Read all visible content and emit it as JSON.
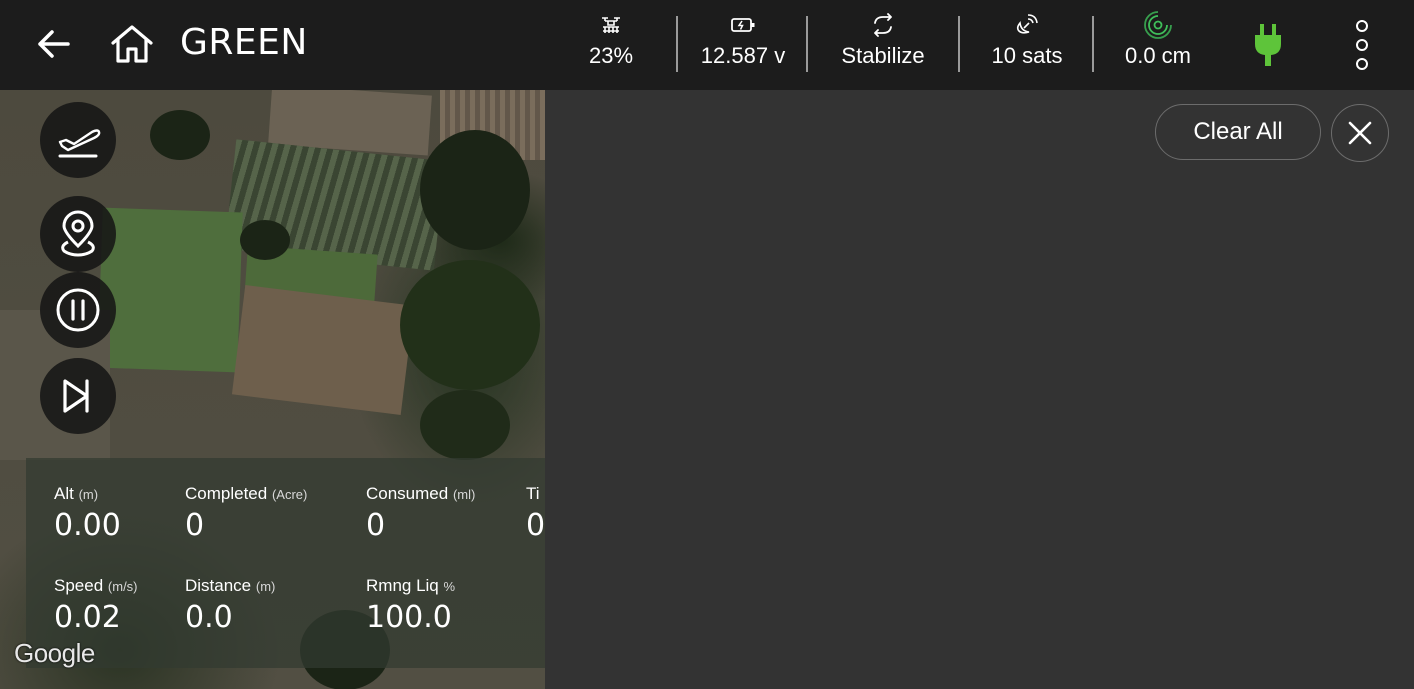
{
  "header": {
    "title": "GREEN",
    "back_icon": "arrow-left-icon",
    "home_icon": "home-icon",
    "stats": [
      {
        "icon": "drone-icon",
        "value": "23%"
      },
      {
        "icon": "battery-icon",
        "value": "12.587 v"
      },
      {
        "icon": "mode-sync-icon",
        "value": "Stabilize"
      },
      {
        "icon": "satellite-icon",
        "value": "10 sats"
      },
      {
        "icon": "rtk-signal-icon",
        "value": "0.0 cm",
        "icon_color": "#3fbf5a"
      }
    ],
    "plug_icon": "power-plug-icon",
    "plug_color": "#5ec43a",
    "menu_icon": "more-vertical-icon"
  },
  "map": {
    "buttons": [
      "takeoff-land-icon",
      "location-pin-icon",
      "pause-icon",
      "skip-next-icon"
    ],
    "attribution": "Google",
    "telemetry": {
      "alt": {
        "label": "Alt",
        "unit": "(m)",
        "value": "0.00"
      },
      "completed": {
        "label": "Completed",
        "unit": "(Acre)",
        "value": "0"
      },
      "consumed": {
        "label": "Consumed",
        "unit": "(ml)",
        "value": "0"
      },
      "time": {
        "label": "Ti",
        "value": "0"
      },
      "speed": {
        "label": "Speed",
        "unit": "(m/s)",
        "value": "0.02"
      },
      "distance": {
        "label": "Distance",
        "unit": "(m)",
        "value": "0.0"
      },
      "remaining": {
        "label": "Rmng Liq",
        "unit": "%",
        "value": "100.0"
      }
    }
  },
  "panel": {
    "clear_all_label": "Clear All",
    "close_icon": "close-icon",
    "background": "#333333"
  }
}
